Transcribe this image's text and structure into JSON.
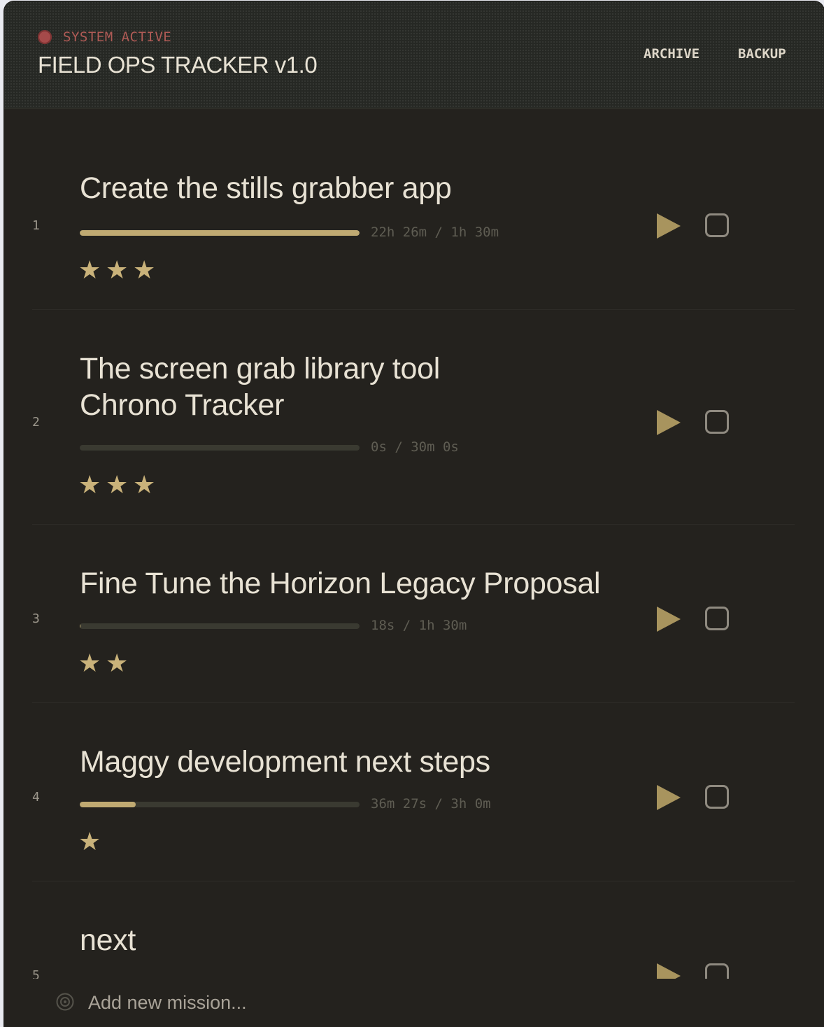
{
  "header": {
    "status": "SYSTEM ACTIVE",
    "title": "FIELD OPS TRACKER v1.0",
    "archive_label": "ARCHIVE",
    "backup_label": "BACKUP"
  },
  "colors": {
    "accent": "#c0aa72",
    "background": "#24221e",
    "status": "#b05b56"
  },
  "missions": [
    {
      "number": "1",
      "title": "Create the stills grabber app",
      "time": "22h 26m / 1h 30m",
      "progress": 1.0,
      "stars": 3
    },
    {
      "number": "2",
      "title_lines": [
        "The screen grab library tool",
        "Chrono Tracker"
      ],
      "time": "0s / 30m 0s",
      "progress": 0.0,
      "stars": 3
    },
    {
      "number": "3",
      "title": "Fine Tune the Horizon Legacy Proposal",
      "time": "18s / 1h 30m",
      "progress": 0.003,
      "stars": 2
    },
    {
      "number": "4",
      "title": "Maggy development next steps",
      "time": "36m 27s / 3h 0m",
      "progress": 0.2,
      "stars": 1
    },
    {
      "number": "5",
      "title": "next"
    }
  ],
  "footer": {
    "add_placeholder": "Add new mission..."
  },
  "icons": {
    "status": "status-dot-icon",
    "play": "play-icon",
    "checkbox": "checkbox-icon",
    "star": "star-icon",
    "add": "target-icon"
  }
}
